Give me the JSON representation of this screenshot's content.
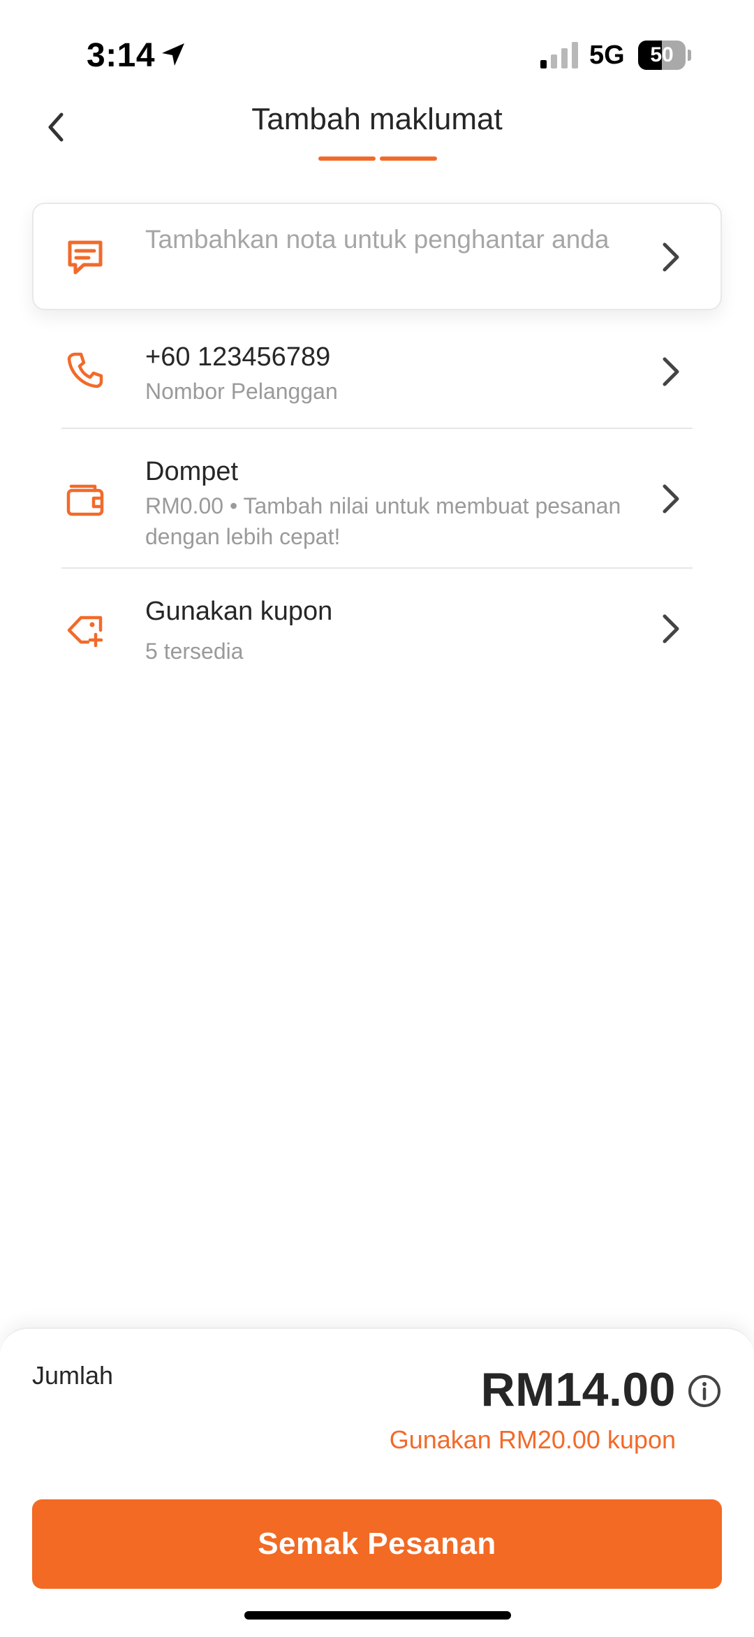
{
  "status_bar": {
    "time": "3:14",
    "network": "5G",
    "battery": "50",
    "battery_level": 0.5
  },
  "header": {
    "title": "Tambah maklumat",
    "progress_steps": 2
  },
  "note": {
    "placeholder": "Tambahkan nota untuk penghantar anda",
    "icon": "message-square-icon"
  },
  "rows": [
    {
      "icon": "phone-icon",
      "title": "+60 123456789",
      "subtitle": "Nombor Pelanggan"
    },
    {
      "icon": "wallet-icon",
      "title": "Dompet",
      "subtitle": "RM0.00 • Tambah nilai untuk membuat pesanan dengan lebih cepat!"
    },
    {
      "icon": "coupon-tag-icon",
      "title": "Gunakan kupon",
      "subtitle": "5 tersedia"
    }
  ],
  "summary": {
    "label": "Jumlah",
    "amount": "RM14.00",
    "coupon_hint": "Gunakan RM20.00 kupon"
  },
  "checkout": {
    "label": "Semak Pesanan"
  },
  "colors": {
    "accent": "#f26a24",
    "text": "#262626",
    "muted": "#9a9a9a"
  }
}
